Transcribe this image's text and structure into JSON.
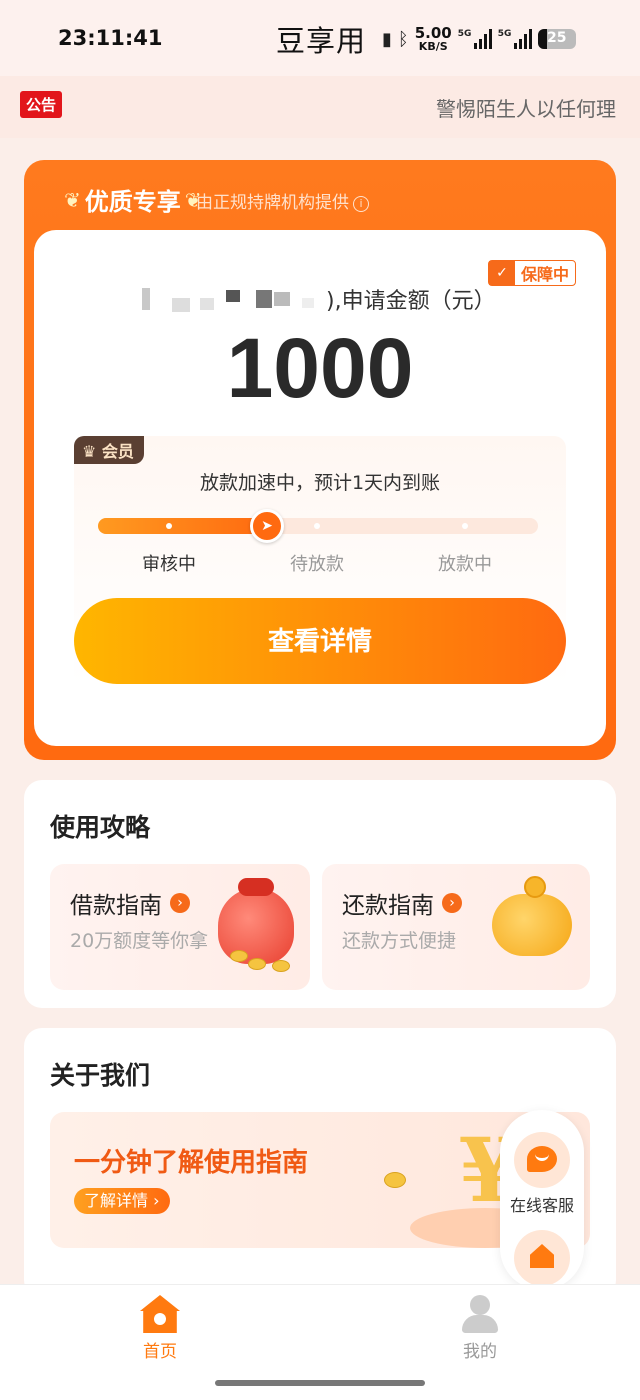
{
  "status_bar": {
    "time": "23:11:41",
    "app_name": "豆享用",
    "net_speed_value": "5.00",
    "net_speed_unit": "KB/S",
    "sim1_label": "5G",
    "sim2_label": "5G",
    "battery": "25"
  },
  "notice": {
    "tag": "公告",
    "text": "警惕陌生人以任何理"
  },
  "card": {
    "badge": "优质专享",
    "subtitle": "由正规持牌机构提供",
    "guard_label": "保障中",
    "apply_label": "),申请金额（元）",
    "amount": "1000",
    "member_tag": "会员",
    "member_text": "放款加速中，预计1天内到账",
    "steps": [
      "审核中",
      "待放款",
      "放款中"
    ],
    "progress_step": 1,
    "detail_button": "查看详情"
  },
  "guide_section": {
    "title": "使用攻略",
    "items": [
      {
        "title": "借款指南",
        "subtitle": "20万额度等你拿"
      },
      {
        "title": "还款指南",
        "subtitle": "还款方式便捷"
      }
    ]
  },
  "about_section": {
    "title": "关于我们",
    "banner_title": "一分钟了解使用指南",
    "banner_button": "了解详情"
  },
  "float": {
    "service_label": "在线客服"
  },
  "tabbar": {
    "home": "首页",
    "mine": "我的",
    "active_color": "#ff7a10",
    "inactive_color": "#999999"
  },
  "colors": {
    "accent": "#ff6a10",
    "notice_red": "#e2151b"
  }
}
